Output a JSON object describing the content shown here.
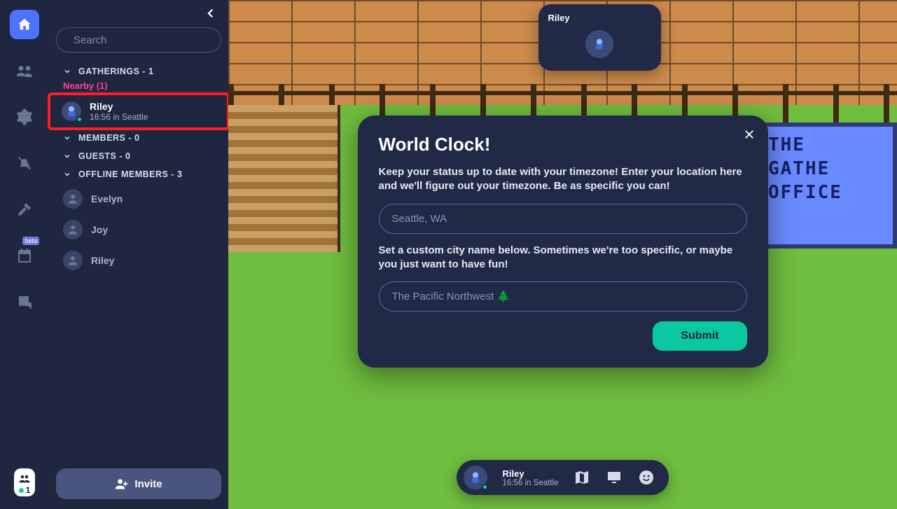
{
  "rail": {
    "home_icon": "house",
    "beta_label": "beta",
    "participants_count": "1"
  },
  "sidebar": {
    "search_placeholder": "Search",
    "sections": {
      "gatherings": "GATHERINGS - 1",
      "members": "MEMBERS - 0",
      "guests": "GUESTS - 0",
      "offline": "OFFLINE MEMBERS - 3"
    },
    "nearby_label": "Nearby (1)",
    "nearby_member": {
      "name": "Riley",
      "sub": "16:56 in Seattle"
    },
    "offline_members": [
      {
        "name": "Evelyn"
      },
      {
        "name": "Joy"
      },
      {
        "name": "Riley"
      }
    ],
    "invite_label": "Invite"
  },
  "world": {
    "sign_text": "THE\nGATHE\nOFFICE",
    "namecard_name": "Riley"
  },
  "modal": {
    "title": "World Clock!",
    "p1": "Keep your status up to date with your timezone! Enter your location here and we'll figure out your timezone. Be as specific you can!",
    "input1_placeholder": "Seattle, WA",
    "p2": "Set a custom city name below. Sometimes we're too specific, or maybe you just want to have fun!",
    "input2_placeholder": "The Pacific Northwest 🌲",
    "submit_label": "Submit"
  },
  "dock": {
    "name": "Riley",
    "sub": "16:56 in Seattle"
  }
}
